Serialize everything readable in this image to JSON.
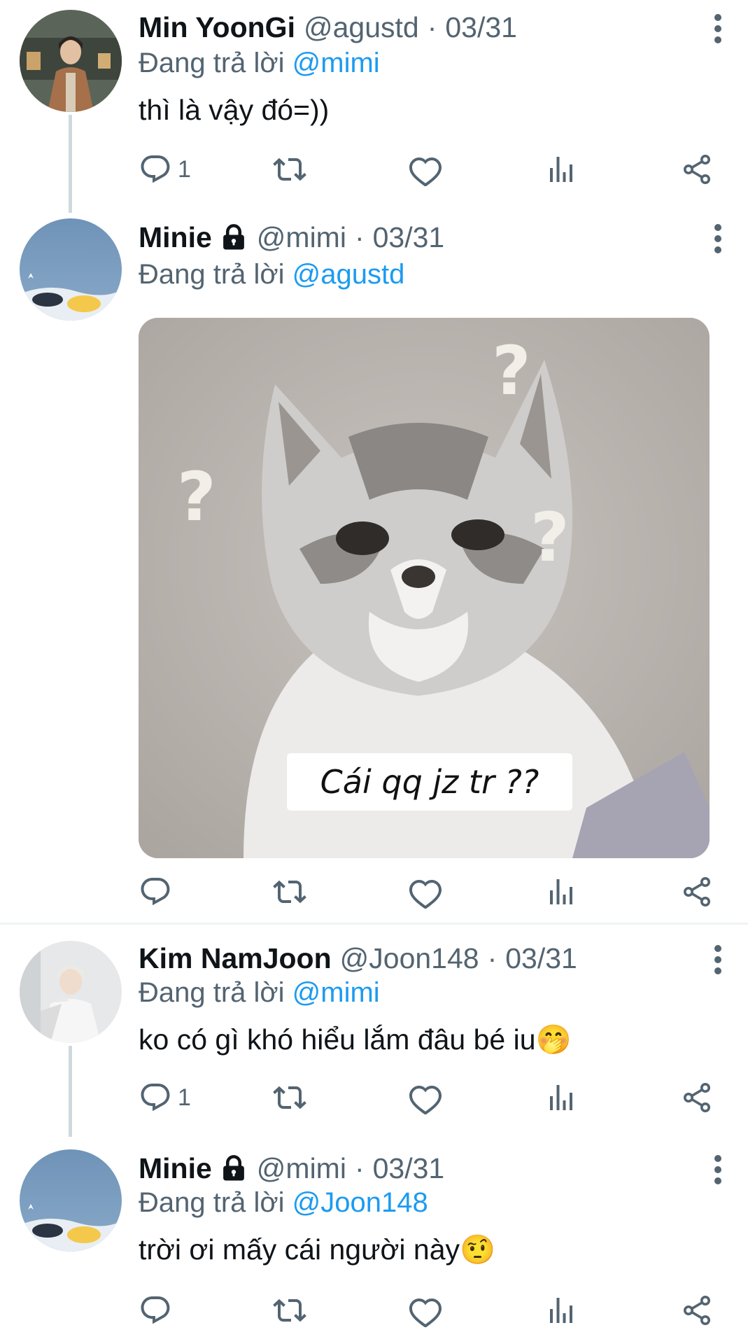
{
  "tweets": [
    {
      "name": "Min YoonGi",
      "handle": "@agustd",
      "separator": "·",
      "date": "03/31",
      "reply_prefix": "Đang trả lời",
      "reply_to": "@mimi",
      "text": "thì là vậy đó=))",
      "reply_count": "1"
    },
    {
      "name": "Minie",
      "handle": "@mimi",
      "separator": "·",
      "date": "03/31",
      "reply_prefix": "Đang trả lời",
      "reply_to": "@agustd",
      "media_caption": "Cái qq jz tr ??",
      "media_marks": [
        "?",
        "?",
        "?"
      ]
    },
    {
      "name": "Kim NamJoon",
      "handle": "@Joon148",
      "separator": "·",
      "date": "03/31",
      "reply_prefix": "Đang trả lời",
      "reply_to": "@mimi",
      "text": "ko có gì khó hiểu lắm đâu bé iu🤭",
      "reply_count": "1"
    },
    {
      "name": "Minie",
      "handle": "@mimi",
      "separator": "·",
      "date": "03/31",
      "reply_prefix": "Đang trả lời",
      "reply_to": "@Joon148",
      "text": "trời ơi mấy cái người này🤨"
    }
  ],
  "icons": {
    "reply": "reply-icon",
    "retweet": "retweet-icon",
    "like": "heart-icon",
    "views": "analytics-icon",
    "share": "share-icon",
    "more": "more-vertical-icon",
    "protected": "lock-icon"
  },
  "colors": {
    "link": "#1d9bf0",
    "secondary_text": "#536471",
    "thread_line": "#cfd9de"
  }
}
